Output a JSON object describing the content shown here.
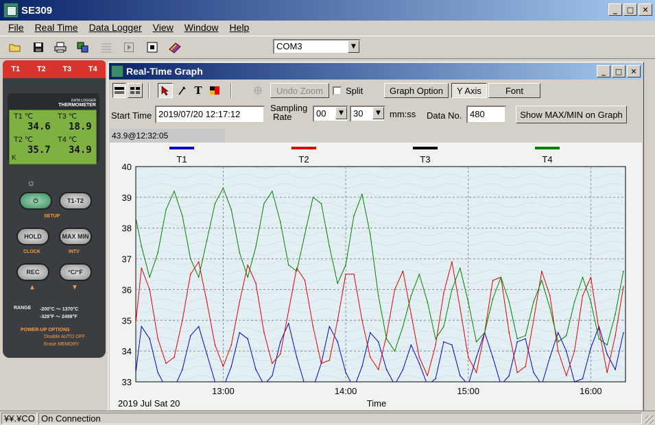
{
  "app": {
    "title": "SE309"
  },
  "menu": [
    "File",
    "Real Time",
    "Data Logger",
    "View",
    "Window",
    "Help"
  ],
  "toolbar": {
    "icons": [
      "open-folder-icon",
      "save-icon",
      "print-icon",
      "copy-icon",
      "grid-icon",
      "play-icon",
      "stop-icon",
      "book-icon"
    ],
    "com_port": "COM3"
  },
  "device": {
    "tabs": [
      "T1",
      "T2",
      "T3",
      "T4"
    ],
    "brand_line1": "DATA LOGGER",
    "brand_line2": "THERMOMETER",
    "lcd": {
      "t1_label": "T1 ℃",
      "t1_value": "34.6",
      "t2_label": "T2 ℃",
      "t2_value": "35.7",
      "t3_label": "T3 ℃",
      "t3_value": "18.9",
      "t4_label": "T4 ℃",
      "t4_value": "34.9",
      "mode": "K"
    },
    "buttons": {
      "t1t2": "T1-T2",
      "hold": "HOLD",
      "maxmin": "MAX MIN",
      "rec": "REC",
      "unit": "°C/°F"
    },
    "labels": {
      "setup": "SETUP",
      "clock": "CLOCK",
      "intv": "INTV",
      "range": "RANGE",
      "range_c": "-200°C ～ 1370°C",
      "range_f": "-328°F ～ 2498°F",
      "powerup": "POWER-UP OPTIONS",
      "opt1": "Disable AUTO OFF",
      "opt2": "Erase MEMORY"
    }
  },
  "graph_window": {
    "title": "Real-Time Graph",
    "toolbar": {
      "undo_zoom": "Undo Zoom",
      "split": "Split",
      "graph_option": "Graph Option",
      "y_axis": "Y Axis",
      "font": "Font"
    },
    "settings": {
      "start_time_label": "Start Time",
      "start_time_value": "2019/07/20 12:17:12",
      "sampling_rate_label_1": "Sampling",
      "sampling_rate_label_2": "Rate",
      "rate_mm": "00",
      "rate_ss": "30",
      "rate_unit": "mm:ss",
      "data_no_label": "Data No.",
      "data_no_value": "480",
      "show_maxmin": "Show MAX/MIN on Graph"
    },
    "readout": "43.9@12:32:05",
    "date_label": "2019 Jul Sat 20"
  },
  "chart_data": {
    "type": "line",
    "xlabel": "Time",
    "ylabel": "",
    "xlim": [
      "12:17:12",
      "16:17"
    ],
    "ylim": [
      33,
      40
    ],
    "yticks": [
      33,
      34,
      35,
      36,
      37,
      38,
      39,
      40
    ],
    "xticks": [
      "13:00",
      "14:00",
      "15:00",
      "16:00"
    ],
    "grid": true,
    "legend_position": "top",
    "series": [
      {
        "name": "T1",
        "color": "#0000cc",
        "x": [
          "12:17",
          "12:20",
          "12:24",
          "12:28",
          "12:32",
          "12:36",
          "12:40",
          "12:44",
          "12:48",
          "12:52",
          "12:56",
          "13:00",
          "13:04",
          "13:08",
          "13:12",
          "13:16",
          "13:20",
          "13:24",
          "13:28",
          "13:32",
          "13:36",
          "13:40",
          "13:44",
          "13:48",
          "13:52",
          "13:56",
          "14:00",
          "14:04",
          "14:08",
          "14:12",
          "14:16",
          "14:20",
          "14:24",
          "14:28",
          "14:32",
          "14:36",
          "14:40",
          "14:44",
          "14:48",
          "14:52",
          "14:56",
          "15:00",
          "15:04",
          "15:08",
          "15:12",
          "15:16",
          "15:20",
          "15:24",
          "15:28",
          "15:32",
          "15:36",
          "15:40",
          "15:44",
          "15:48",
          "15:52",
          "15:56",
          "16:00",
          "16:04",
          "16:08",
          "16:12",
          "16:16"
        ],
        "values": [
          33.2,
          34.8,
          34.4,
          33.3,
          32.8,
          32.8,
          33.4,
          34.5,
          34.8,
          33.9,
          33.0,
          32.8,
          33.5,
          34.6,
          34.4,
          33.4,
          32.9,
          33.2,
          34.3,
          34.9,
          33.8,
          32.9,
          32.8,
          33.6,
          34.8,
          34.3,
          33.3,
          32.8,
          33.5,
          34.6,
          34.3,
          33.4,
          32.9,
          33.4,
          34.2,
          33.6,
          32.9,
          33.1,
          34.3,
          34.2,
          33.2,
          32.9,
          33.8,
          34.6,
          33.8,
          32.9,
          33.2,
          34.3,
          34.4,
          33.3,
          32.9,
          33.8,
          34.6,
          34.0,
          33.0,
          33.1,
          34.1,
          34.8,
          33.9,
          33.4,
          34.6
        ]
      },
      {
        "name": "T2",
        "color": "#dd0000",
        "x": [
          "12:17",
          "12:20",
          "12:24",
          "12:28",
          "12:32",
          "12:36",
          "12:40",
          "12:44",
          "12:48",
          "12:52",
          "12:56",
          "13:00",
          "13:04",
          "13:08",
          "13:12",
          "13:16",
          "13:20",
          "13:24",
          "13:28",
          "13:32",
          "13:36",
          "13:40",
          "13:44",
          "13:48",
          "13:52",
          "13:56",
          "14:00",
          "14:04",
          "14:08",
          "14:12",
          "14:16",
          "14:20",
          "14:24",
          "14:28",
          "14:32",
          "14:36",
          "14:40",
          "14:44",
          "14:48",
          "14:52",
          "14:56",
          "15:00",
          "15:04",
          "15:08",
          "15:12",
          "15:16",
          "15:20",
          "15:24",
          "15:28",
          "15:32",
          "15:36",
          "15:40",
          "15:44",
          "15:48",
          "15:52",
          "15:56",
          "16:00",
          "16:04",
          "16:08",
          "16:12",
          "16:16"
        ],
        "values": [
          34.8,
          36.7,
          36.0,
          34.4,
          33.6,
          33.8,
          35.0,
          36.5,
          36.9,
          35.6,
          34.2,
          33.5,
          34.2,
          35.6,
          36.8,
          36.2,
          34.6,
          33.6,
          33.9,
          35.3,
          36.7,
          36.3,
          34.8,
          33.6,
          33.7,
          35.0,
          36.5,
          36.5,
          35.0,
          33.8,
          33.4,
          34.5,
          36.0,
          36.6,
          35.2,
          33.8,
          33.2,
          34.2,
          35.9,
          36.9,
          35.4,
          33.8,
          33.3,
          34.6,
          36.3,
          36.4,
          34.6,
          33.3,
          33.5,
          35.0,
          36.6,
          35.8,
          34.0,
          33.2,
          34.0,
          35.8,
          36.4,
          34.7,
          33.3,
          34.5,
          36.1
        ]
      },
      {
        "name": "T3",
        "color": "#000000",
        "x": [],
        "values": []
      },
      {
        "name": "T4",
        "color": "#008000",
        "x": [
          "12:17",
          "12:20",
          "12:24",
          "12:28",
          "12:32",
          "12:36",
          "12:40",
          "12:44",
          "12:48",
          "12:52",
          "12:56",
          "13:00",
          "13:04",
          "13:08",
          "13:12",
          "13:16",
          "13:20",
          "13:24",
          "13:28",
          "13:32",
          "13:36",
          "13:40",
          "13:44",
          "13:48",
          "13:52",
          "13:56",
          "14:00",
          "14:04",
          "14:08",
          "14:12",
          "14:16",
          "14:20",
          "14:24",
          "14:28",
          "14:32",
          "14:36",
          "14:40",
          "14:44",
          "14:48",
          "14:52",
          "14:56",
          "15:00",
          "15:04",
          "15:08",
          "15:12",
          "15:16",
          "15:20",
          "15:24",
          "15:28",
          "15:32",
          "15:36",
          "15:40",
          "15:44",
          "15:48",
          "15:52",
          "15:56",
          "16:00",
          "16:04",
          "16:08",
          "16:12",
          "16:16"
        ],
        "values": [
          38.4,
          37.4,
          36.4,
          37.2,
          38.6,
          39.2,
          38.4,
          37.0,
          36.4,
          37.6,
          38.8,
          39.3,
          38.6,
          37.2,
          36.4,
          37.4,
          38.8,
          39.2,
          38.2,
          36.8,
          36.6,
          37.8,
          39.0,
          38.8,
          37.4,
          36.2,
          36.8,
          38.4,
          39.1,
          37.8,
          35.8,
          34.4,
          34.0,
          34.8,
          35.8,
          36.5,
          35.6,
          34.4,
          34.8,
          36.0,
          36.7,
          35.6,
          34.3,
          34.6,
          35.7,
          36.4,
          35.6,
          34.4,
          34.5,
          35.6,
          36.3,
          35.4,
          34.3,
          34.5,
          35.6,
          36.4,
          35.6,
          34.4,
          34.2,
          35.2,
          36.6
        ]
      }
    ]
  }
}
